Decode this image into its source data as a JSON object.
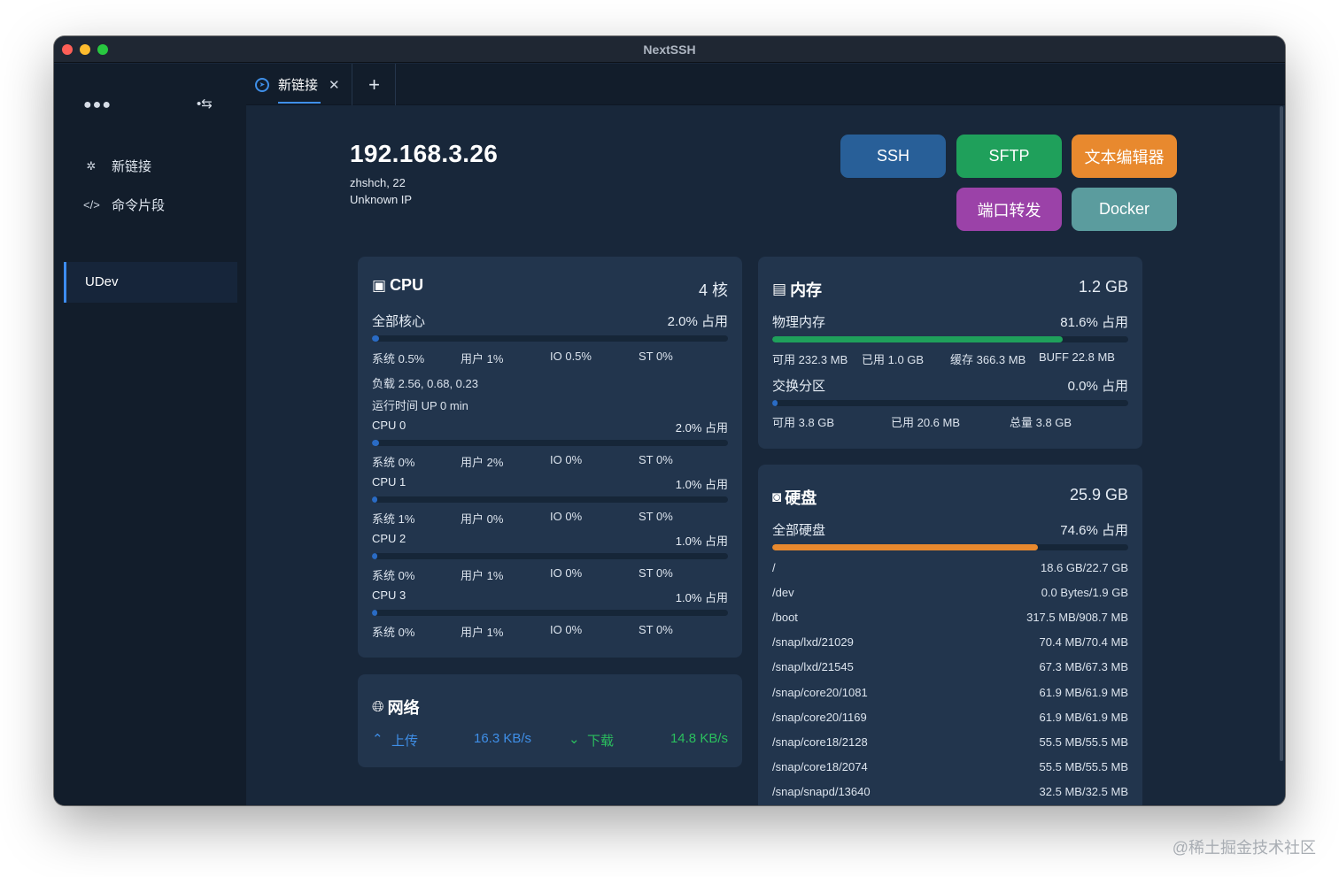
{
  "window": {
    "title": "NextSSH"
  },
  "sidebar": {
    "items": [
      {
        "icon": "network-icon",
        "label": "新链接"
      },
      {
        "icon": "code-icon",
        "label": "命令片段"
      }
    ],
    "group": "UDev"
  },
  "tabs": [
    {
      "label": "新链接",
      "close": "✕"
    }
  ],
  "tab_add": "+",
  "host": {
    "ip": "192.168.3.26",
    "user_port": "zhshch, 22",
    "location": "Unknown IP"
  },
  "buttons": {
    "ssh": "SSH",
    "sftp": "SFTP",
    "editor": "文本编辑器",
    "port": "端口转发",
    "docker": "Docker"
  },
  "cpu": {
    "title": "CPU",
    "cores": "4 核",
    "total": {
      "label": "全部核心",
      "usage": "2.0% 占用",
      "fraction": 0.02,
      "sys": "系统 0.5%",
      "user": "用户 1%",
      "io": "IO 0.5%",
      "st": "ST 0%"
    },
    "load": "负载 2.56, 0.68, 0.23",
    "uptime": "运行时间 UP 0 min",
    "per_core": [
      {
        "label": "CPU 0",
        "usage": "2.0% 占用",
        "fraction": 0.02,
        "sys": "系统 0%",
        "user": "用户 2%",
        "io": "IO 0%",
        "st": "ST 0%"
      },
      {
        "label": "CPU 1",
        "usage": "1.0% 占用",
        "fraction": 0.01,
        "sys": "系统 1%",
        "user": "用户 0%",
        "io": "IO 0%",
        "st": "ST 0%"
      },
      {
        "label": "CPU 2",
        "usage": "1.0% 占用",
        "fraction": 0.01,
        "sys": "系统 0%",
        "user": "用户 1%",
        "io": "IO 0%",
        "st": "ST 0%"
      },
      {
        "label": "CPU 3",
        "usage": "1.0% 占用",
        "fraction": 0.01,
        "sys": "系统 0%",
        "user": "用户 1%",
        "io": "IO 0%",
        "st": "ST 0%"
      }
    ]
  },
  "memory": {
    "title": "内存",
    "total": "1.2 GB",
    "physical": {
      "label": "物理内存",
      "usage": "81.6% 占用",
      "fraction": 0.816,
      "available": "可用 232.3 MB",
      "used": "已用 1.0 GB",
      "cache": "缓存 366.3 MB",
      "buff": "BUFF 22.8 MB"
    },
    "swap": {
      "label": "交换分区",
      "usage": "0.0% 占用",
      "fraction": 0.0,
      "available": "可用 3.8 GB",
      "used": "已用 20.6 MB",
      "total": "总量 3.8 GB"
    }
  },
  "network": {
    "title": "网络",
    "upload_label": "上传",
    "upload_speed": "16.3 KB/s",
    "download_label": "下载",
    "download_speed": "14.8 KB/s"
  },
  "disk": {
    "title": "硬盘",
    "total": "25.9 GB",
    "all": {
      "label": "全部硬盘",
      "usage": "74.6% 占用",
      "fraction": 0.746
    },
    "mounts": [
      {
        "path": "/",
        "usage": "18.6 GB/22.7 GB"
      },
      {
        "path": "/dev",
        "usage": "0.0 Bytes/1.9 GB"
      },
      {
        "path": "/boot",
        "usage": "317.5 MB/908.7 MB"
      },
      {
        "path": "/snap/lxd/21029",
        "usage": "70.4 MB/70.4 MB"
      },
      {
        "path": "/snap/lxd/21545",
        "usage": "67.3 MB/67.3 MB"
      },
      {
        "path": "/snap/core20/1081",
        "usage": "61.9 MB/61.9 MB"
      },
      {
        "path": "/snap/core20/1169",
        "usage": "61.9 MB/61.9 MB"
      },
      {
        "path": "/snap/core18/2128",
        "usage": "55.5 MB/55.5 MB"
      },
      {
        "path": "/snap/core18/2074",
        "usage": "55.5 MB/55.5 MB"
      },
      {
        "path": "/snap/snapd/13640",
        "usage": "32.5 MB/32.5 MB"
      }
    ]
  },
  "colors": {
    "cpu_bar": "#2a6bc4",
    "mem_bar": "#1fa05b",
    "disk_bar": "#e8892e",
    "upload": "#3f8fe8",
    "download": "#2bbf5e"
  },
  "watermark": "@稀土掘金技术社区"
}
